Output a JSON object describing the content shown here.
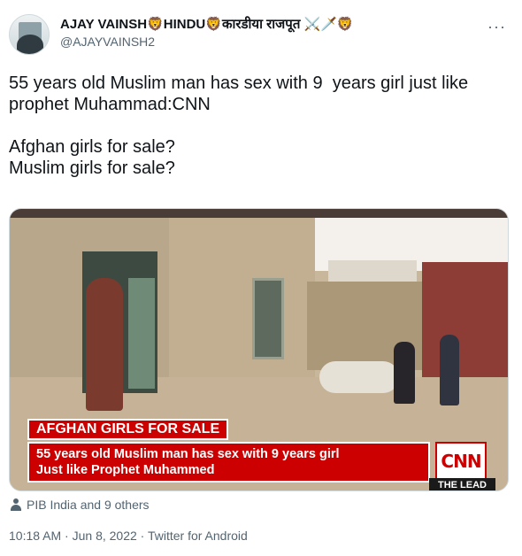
{
  "author": {
    "display_name": "AJAY VAINSH🦁HINDU🦁कारडीया राजपूत ⚔️🗡️🦁",
    "handle": "@AJAYVAINSH2"
  },
  "menu": {
    "more_label": "···"
  },
  "tweet": {
    "text": "55 years old Muslim man has sex with 9  years girl just like prophet Muhammad:CNN\n\nAfghan girls for sale?\nMuslim girls for sale?"
  },
  "media": {
    "banner_tag": "AFGHAN GIRLS FOR SALE",
    "headline_line1": "55 years old Muslim man has sex with 9 years girl",
    "headline_line2": "Just like Prophet Muhammed",
    "logo": "CNN",
    "show_name": "THE LEAD"
  },
  "tagged": {
    "text": "PIB India and 9 others"
  },
  "meta": {
    "time": "10:18 AM",
    "separator": "·",
    "date": "Jun 8, 2022",
    "source": "Twitter for Android"
  },
  "colors": {
    "cnn_red": "#cc0000",
    "secondary_text": "#536471"
  }
}
